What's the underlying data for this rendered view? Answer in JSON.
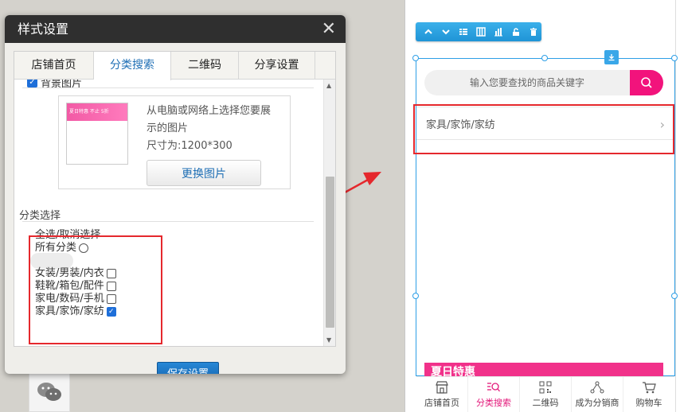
{
  "dialog": {
    "title": "样式设置",
    "close": "✕",
    "tabs": [
      {
        "label": "店铺首页"
      },
      {
        "label": "分类搜索"
      },
      {
        "label": "二维码"
      },
      {
        "label": "分享设置"
      }
    ],
    "partial_label": "背景图片",
    "image": {
      "desc_line1": "从电脑或网络上选择您要展",
      "desc_line2": "示的图片",
      "size": "尺寸为:1200*300",
      "replace_label": "更换图片",
      "thumb_text": "夏日特惠 不止 5折"
    },
    "category_section": {
      "title": "分类选择",
      "select_all": "全选/取消选择",
      "all_categories": "所有分类",
      "items": [
        {
          "label": "女装/男装/内衣",
          "checked": false
        },
        {
          "label": "鞋靴/箱包/配件",
          "checked": false
        },
        {
          "label": "家电/数码/手机",
          "checked": false
        },
        {
          "label": "家具/家饰/家纺",
          "checked": true
        }
      ]
    },
    "save_label": "保存设置"
  },
  "preview": {
    "search_placeholder": "输入您要查找的商品关键字",
    "category_row": "家具/家饰/家纺",
    "banner_text": "夏日特惠",
    "nav": [
      {
        "label": "店铺首页",
        "icon": "store-icon"
      },
      {
        "label": "分类搜索",
        "icon": "category-search-icon"
      },
      {
        "label": "二维码",
        "icon": "qrcode-icon"
      },
      {
        "label": "成为分销商",
        "icon": "share-icon"
      },
      {
        "label": "购物车",
        "icon": "cart-icon"
      }
    ]
  },
  "colors": {
    "accent_blue": "#1f6fb5",
    "pink": "#f2137c",
    "highlight_red": "#e5282d",
    "toolbar_blue": "#2196d8"
  }
}
